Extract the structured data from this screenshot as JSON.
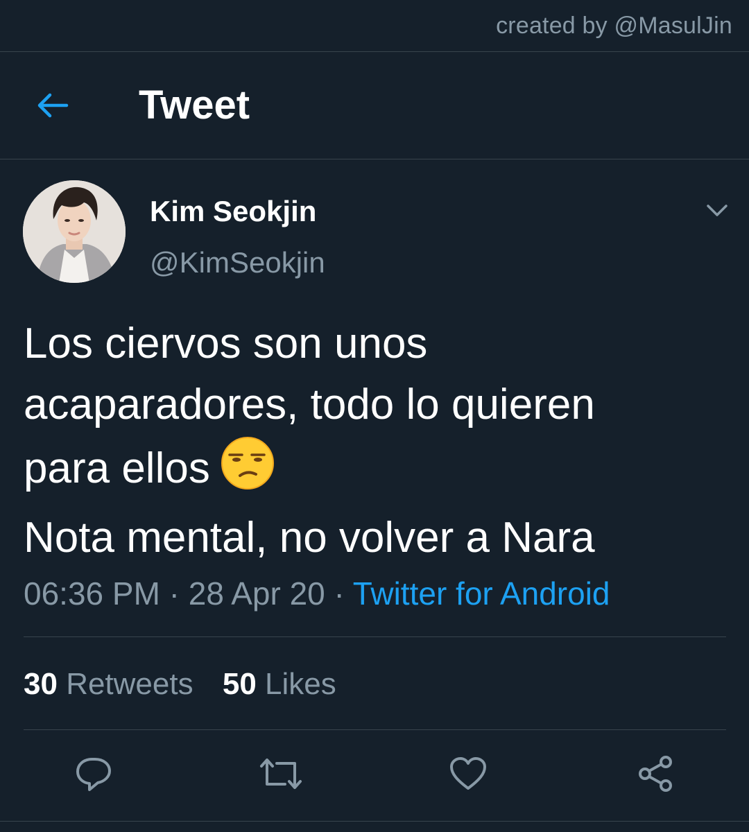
{
  "watermark": "created by @MasulJin",
  "header": {
    "title": "Tweet",
    "back_icon": "arrow-left-icon"
  },
  "tweet": {
    "author_name": "Kim Seokjin",
    "author_handle": "@KimSeokjin",
    "text_lines": [
      "Los ciervos son unos",
      "acaparadores, todo lo quieren",
      "para ellos",
      "Nota mental, no volver a Nara"
    ],
    "emoji": "unamused-face",
    "time": "06:36 PM",
    "separator": " · ",
    "date": "28 Apr 20",
    "source": "Twitter for Android",
    "retweets_count": "30",
    "retweets_label": "Retweets",
    "likes_count": "50",
    "likes_label": "Likes"
  },
  "actions": [
    "reply-icon",
    "retweet-icon",
    "like-icon",
    "share-icon"
  ],
  "colors": {
    "background": "#15202b",
    "divider": "#38444d",
    "accent": "#1da1f2",
    "muted": "#8899a6",
    "text": "#ffffff"
  }
}
